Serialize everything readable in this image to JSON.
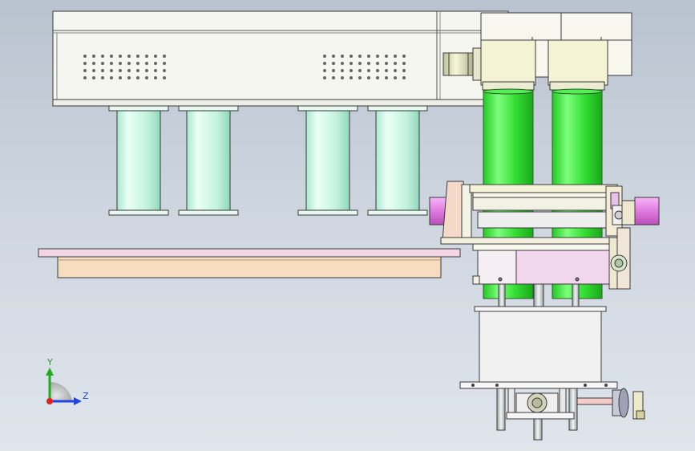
{
  "view": {
    "triad": {
      "y_label": "Y",
      "z_label": "Z"
    }
  },
  "colors": {
    "background_top": "#b9c3cf",
    "background_bottom": "#e0e5ec",
    "outline": "#3a3a3a",
    "housing": "#f4f4ee",
    "pillar": "#c8f0e0",
    "cylinder": "#33dd33",
    "cylinder_highlight": "#aaffaa",
    "motor_block": "#f2f2d0",
    "plate_pink": "#f2d6e6",
    "plate_peach": "#f7dcc0",
    "shaft_magenta": "#e07ae0",
    "base_box": "#f2f2f2",
    "axis_y": "#22aa22",
    "axis_z": "#2244dd",
    "axis_x": "#dd2222"
  },
  "parts": {
    "vent_grid_rows": 4,
    "vent_grid_cols": 10,
    "pillar_count": 4,
    "cylinder_count": 2
  }
}
